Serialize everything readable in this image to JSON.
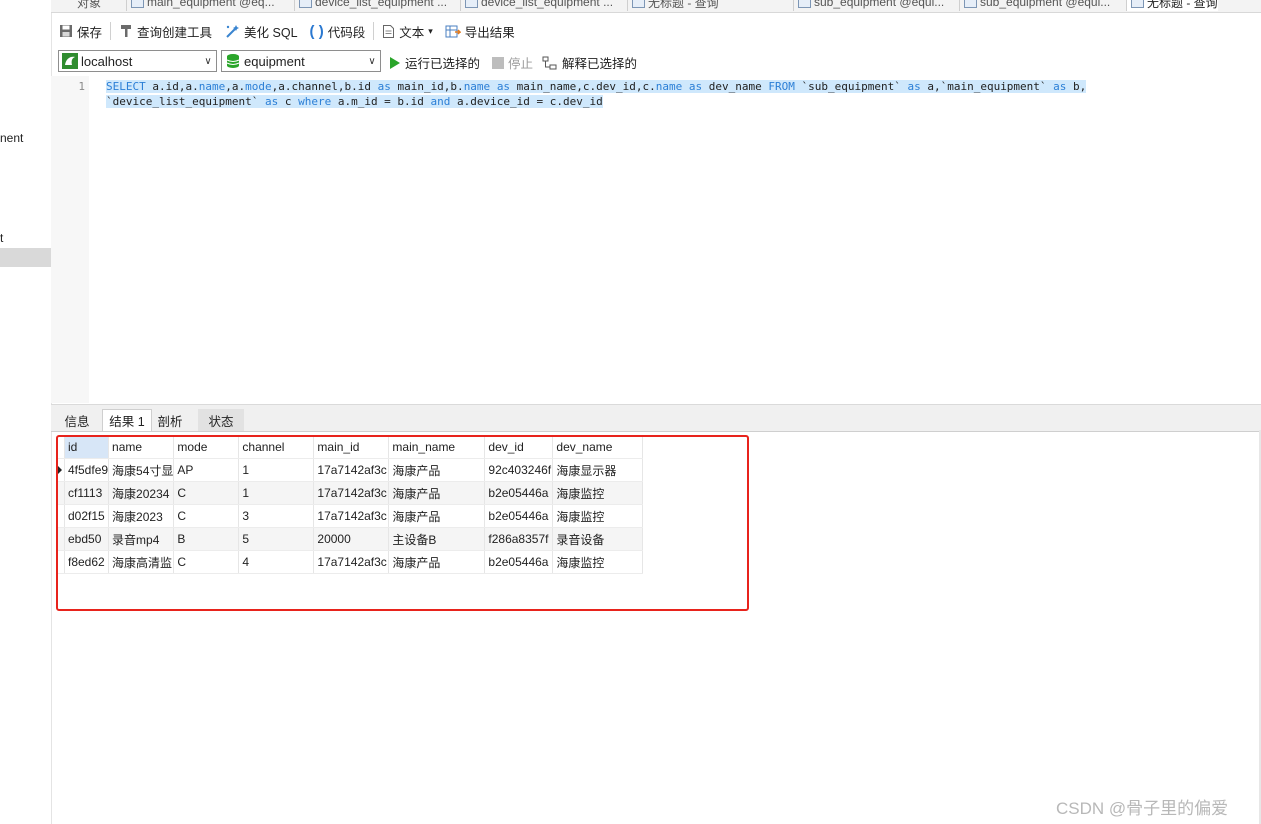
{
  "left_pane": {
    "items": [
      "nent",
      "t"
    ]
  },
  "tabs": [
    {
      "label": "对象"
    },
    {
      "label": "main_equipment @eq..."
    },
    {
      "label": "device_list_equipment ..."
    },
    {
      "label": "device_list_equipment ..."
    },
    {
      "label": "无标题 - 查询"
    },
    {
      "label": "sub_equipment @equi..."
    },
    {
      "label": "sub_equipment @equi..."
    },
    {
      "label": "无标题 - 查询"
    }
  ],
  "toolbar": {
    "save": "保存",
    "query_builder": "查询创建工具",
    "beautify": "美化 SQL",
    "code_snippet": "代码段",
    "text": "文本",
    "export": "导出结果"
  },
  "connection": {
    "host": "localhost",
    "database": "equipment",
    "run_selected": "运行已选择的",
    "stop": "停止",
    "explain_selected": "解释已选择的"
  },
  "editor": {
    "line_number": "1",
    "line1": [
      {
        "t": "SELECT",
        "k": 1
      },
      {
        "t": " a.id,a.",
        "k": 0
      },
      {
        "t": "name",
        "k": 1
      },
      {
        "t": ",a.",
        "k": 0
      },
      {
        "t": "mode",
        "k": 1
      },
      {
        "t": ",a.channel,b.id ",
        "k": 0
      },
      {
        "t": "as",
        "k": 1
      },
      {
        "t": " main_id,b.",
        "k": 0
      },
      {
        "t": "name",
        "k": 1
      },
      {
        "t": " ",
        "k": 0
      },
      {
        "t": "as",
        "k": 1
      },
      {
        "t": " main_name,c.dev_id,c.",
        "k": 0
      },
      {
        "t": "name",
        "k": 1
      },
      {
        "t": " ",
        "k": 0
      },
      {
        "t": "as",
        "k": 1
      },
      {
        "t": " dev_name ",
        "k": 0
      },
      {
        "t": "FROM",
        "k": 1
      },
      {
        "t": " `sub_equipment` ",
        "k": 0
      },
      {
        "t": "as",
        "k": 1
      },
      {
        "t": " a,`main_equipment` ",
        "k": 0
      },
      {
        "t": "as",
        "k": 1
      },
      {
        "t": " b,",
        "k": 0
      }
    ],
    "line2": [
      {
        "t": "`device_list_equipment` ",
        "k": 0
      },
      {
        "t": "as",
        "k": 1
      },
      {
        "t": " c ",
        "k": 0
      },
      {
        "t": "where",
        "k": 1
      },
      {
        "t": " a.m_id = b.id ",
        "k": 0
      },
      {
        "t": "and",
        "k": 1
      },
      {
        "t": " a.device_id = c.dev_id",
        "k": 0
      }
    ]
  },
  "result_tabs": [
    {
      "label": "信息"
    },
    {
      "label": "结果 1"
    },
    {
      "label": "剖析"
    },
    {
      "label": "状态"
    }
  ],
  "grid": {
    "columns": [
      "id",
      "name",
      "mode",
      "channel",
      "main_id",
      "main_name",
      "dev_id",
      "dev_name"
    ],
    "rows": [
      [
        "4f5dfe9",
        "海康54寸显",
        "AP",
        "1",
        "17a7142af3c",
        "海康产品",
        "92c403246f",
        "海康显示器"
      ],
      [
        "cf1113",
        "海康20234",
        "C",
        "1",
        "17a7142af3c",
        "海康产品",
        "b2e05446a",
        "海康监控"
      ],
      [
        "d02f15",
        "海康2023",
        "C",
        "3",
        "17a7142af3c",
        "海康产品",
        "b2e05446a",
        "海康监控"
      ],
      [
        "ebd50",
        "录音mp4",
        "B",
        "5",
        "20000",
        "主设备B",
        "f286a8357f",
        "录音设备"
      ],
      [
        "f8ed62",
        "海康高清监",
        "C",
        "4",
        "17a7142af3c",
        "海康产品",
        "b2e05446a",
        "海康监控"
      ]
    ]
  },
  "watermark": "CSDN @骨子里的偏爱",
  "colors": {
    "keyword": "#2c7fd6",
    "selection": "#cfe8fc",
    "annotation_box": "#e8231c",
    "run_icon": "#2aa52a"
  }
}
